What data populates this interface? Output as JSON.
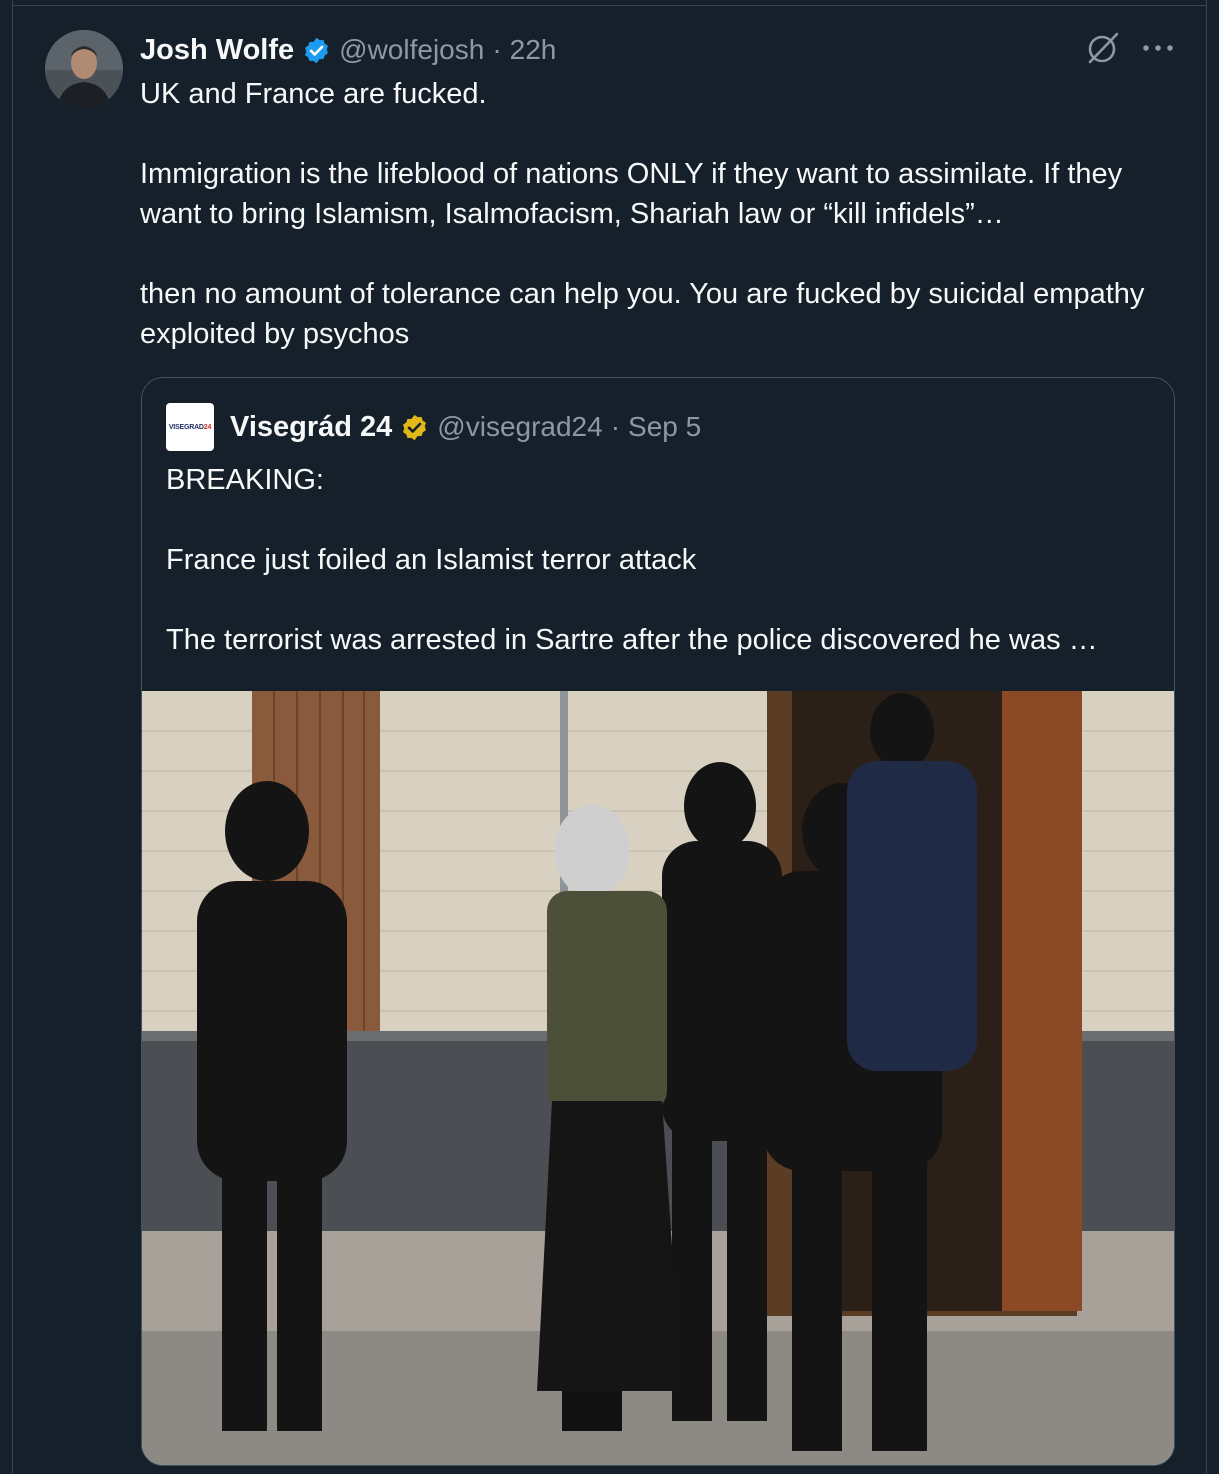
{
  "tweet": {
    "author_name": "Josh Wolfe",
    "author_handle": "@wolfejosh",
    "separator": "·",
    "time": "22h",
    "verified_icon": "verified-badge-icon",
    "body": "UK and France are fucked.\n\nImmigration is the lifeblood of nations ONLY if they want to assimilate. If they want to bring Islamism, Isalmofacism, Shariah law or “kill infidels”…\n\nthen no amount of tolerance can help you. You are fucked by suicidal empathy exploited by psychos"
  },
  "quote": {
    "author_name": "Visegrád 24",
    "author_handle": "@visegrad24",
    "separator": "·",
    "time": "Sep 5",
    "avatar_text": "VISEGRAD",
    "avatar_num": "24",
    "body": "BREAKING:\n\nFrance just foiled an Islamist terror attack\n\nThe terrorist was arrested in Sartre after the police discovered he was …",
    "image_icon": "police-arrest-photo"
  },
  "colors": {
    "background": "#15202b",
    "text": "#f7f9f9",
    "secondary": "#8b98a5",
    "verified_blue": "#1d9bf0",
    "verified_gold": "#e2b719"
  }
}
